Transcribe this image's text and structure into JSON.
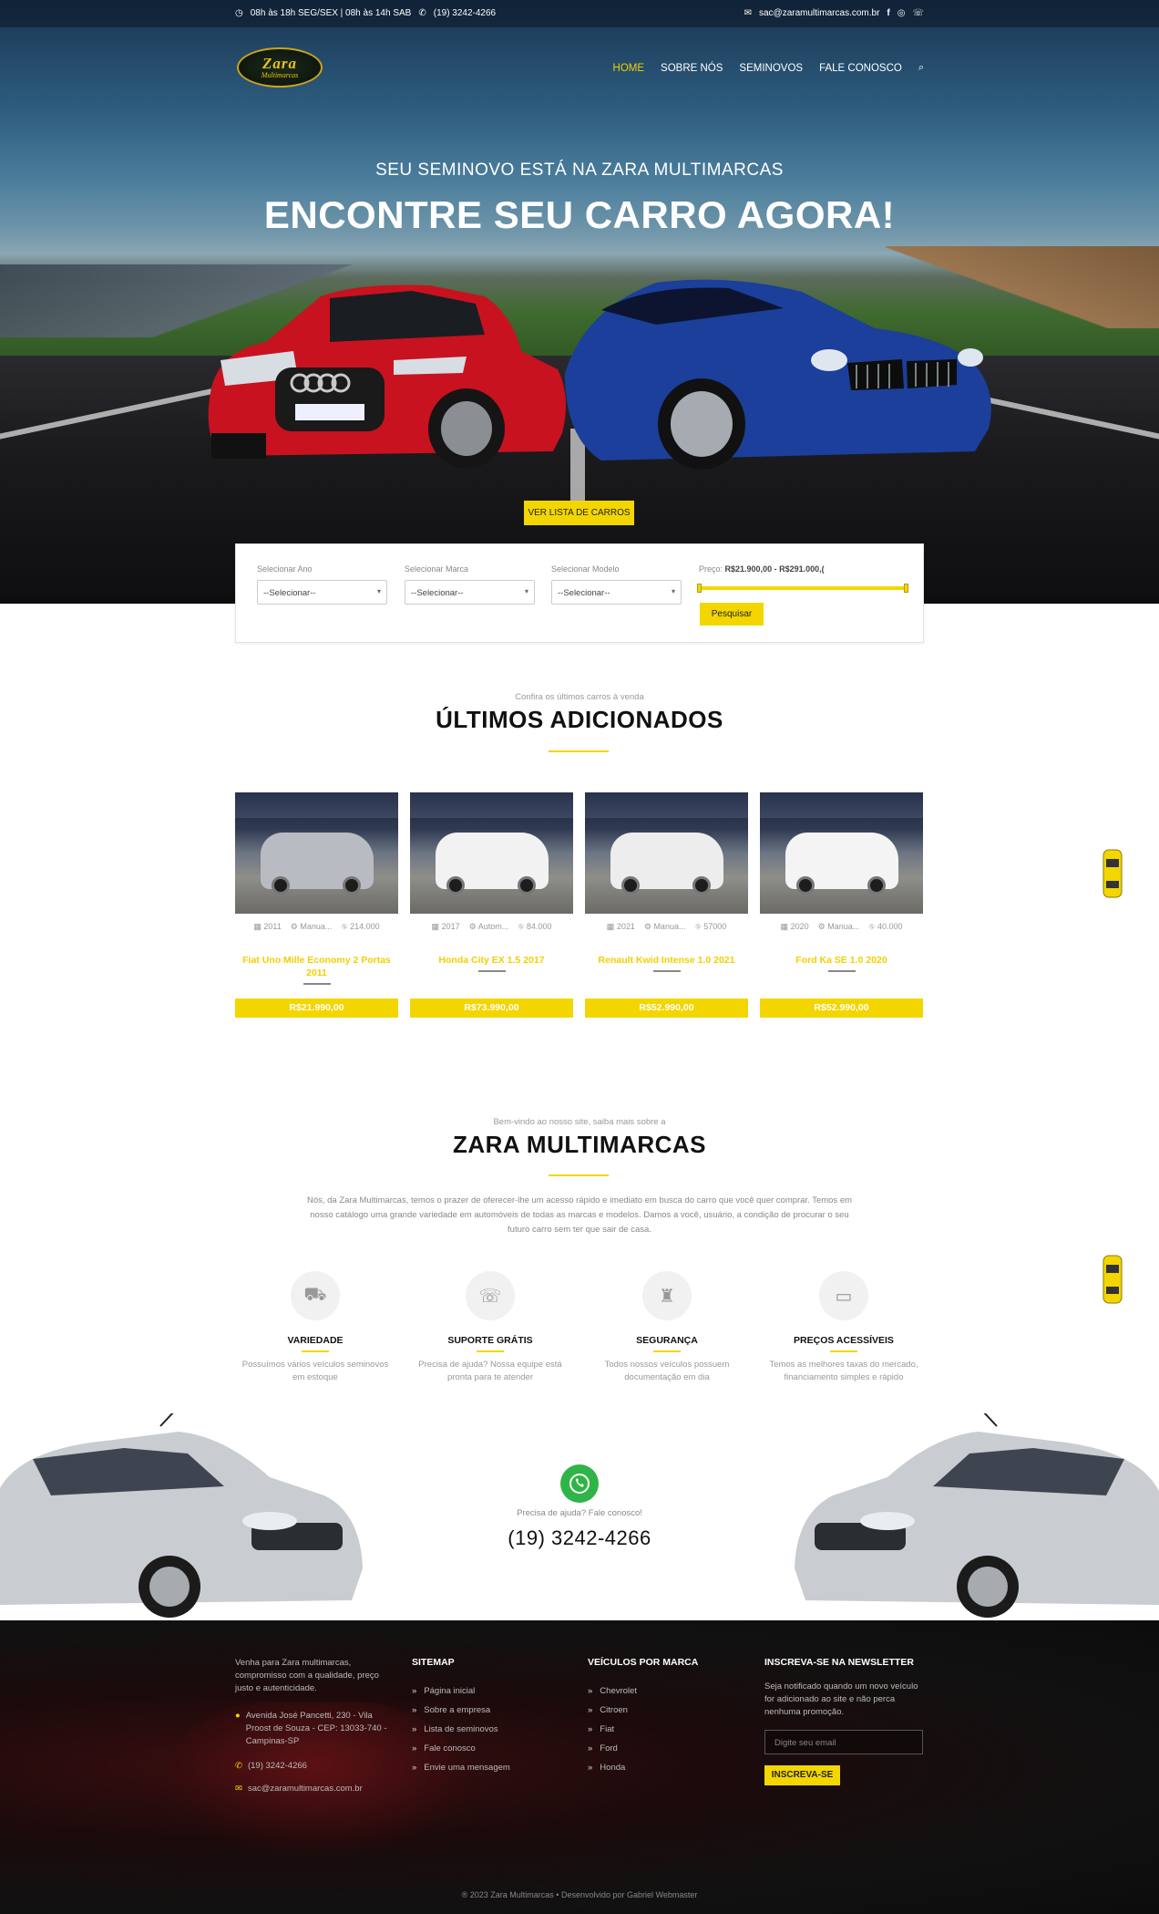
{
  "topbar": {
    "hours": "08h às 18h SEG/SEX | 08h às 14h SAB",
    "phone": "(19) 3242-4266",
    "email": "sac@zaramultimarcas.com.br"
  },
  "logo": {
    "line1": "Zara",
    "line2": "Multimarcas"
  },
  "nav": [
    {
      "label": "HOME",
      "active": true
    },
    {
      "label": "SOBRE NÓS"
    },
    {
      "label": "SEMINOVOS"
    },
    {
      "label": "FALE CONOSCO"
    }
  ],
  "hero": {
    "subtitle": "SEU SEMINOVO ESTÁ NA ZARA MULTIMARCAS",
    "title": "ENCONTRE SEU CARRO AGORA!",
    "button": "VER LISTA DE CARROS"
  },
  "search": {
    "ano_label": "Selecionar Ano",
    "marca_label": "Selecionar Marca",
    "modelo_label": "Selecionar Modelo",
    "select_value": "--Selecionar--",
    "price_label": "Preço:",
    "price_range": "R$21.900,00 - R$291.000,(",
    "price_min": 21900,
    "price_max": 291000,
    "button": "Pesquisar"
  },
  "latest": {
    "kicker": "Confira os últimos carros à venda",
    "title": "ÚLTIMOS ADICIONADOS",
    "cars": [
      {
        "year": "2011",
        "trans": "Manua...",
        "km": "214.000",
        "name": "Fiat Uno Mille Economy 2 Portas 2011",
        "price": "R$21.990,00",
        "color": "#b8bcc2"
      },
      {
        "year": "2017",
        "trans": "Autom...",
        "km": "84.000",
        "name": "Honda City EX 1.5 2017",
        "price": "R$73.990,00",
        "color": "#f2f2f2"
      },
      {
        "year": "2021",
        "trans": "Manua...",
        "km": "57000",
        "name": "Renault Kwid Intense 1.0 2021",
        "price": "R$52.990,00",
        "color": "#ededed"
      },
      {
        "year": "2020",
        "trans": "Manua...",
        "km": "40.000",
        "name": "Ford Ka SE 1.0 2020",
        "price": "R$52.990,00",
        "color": "#f4f4f4"
      }
    ]
  },
  "about": {
    "kicker": "Bem-vindo ao nosso site, saiba mais sobre a",
    "title": "ZARA MULTIMARCAS",
    "text": "Nós, da Zara Multimarcas, temos o prazer de oferecer-lhe um acesso rápido e imediato em busca do carro que você quer comprar. Temos em nosso catálogo uma grande variedade em automóveis de todas as marcas e modelos. Damos a você, usuário, a condição de procurar o seu futuro carro sem ter que sair de casa.",
    "features": [
      {
        "icon": "car-front-icon",
        "title": "VARIEDADE",
        "desc": "Possuímos vários veículos seminovos em estoque"
      },
      {
        "icon": "chat-bubble-icon",
        "title": "SUPORTE GRÁTIS",
        "desc": "Precisa de ajuda? Nossa equipe está pronta para te atender"
      },
      {
        "icon": "fire-extinguisher-icon",
        "title": "SEGURANÇA",
        "desc": "Todos nossos veículos possuem documentação em dia"
      },
      {
        "icon": "wallet-icon",
        "title": "PREÇOS ACESSÍVEIS",
        "desc": "Temos as melhores taxas do mercado, financiamento simples e rápido"
      }
    ]
  },
  "contact": {
    "help": "Precisa de ajuda? Fale conosco!",
    "phone": "(19) 3242-4266"
  },
  "footer": {
    "intro": "Venha para Zara multimarcas, compromisso com a qualidade, preço justo e autenticidade.",
    "address": "Avenida José Pancetti, 230 - Vila Proost de Souza - CEP: 13033-740 - Campinas-SP",
    "phone": "(19) 3242-4266",
    "email": "sac@zaramultimarcas.com.br",
    "sitemap_title": "SITEMAP",
    "sitemap": [
      "Página inicial",
      "Sobre a empresa",
      "Lista de seminovos",
      "Fale conosco",
      "Envie uma mensagem"
    ],
    "brands_title": "VEÍCULOS POR MARCA",
    "brands": [
      "Chevrolet",
      "Citroen",
      "Fiat",
      "Ford",
      "Honda"
    ],
    "newsletter_title": "INSCREVA-SE NA NEWSLETTER",
    "newsletter_text": "Seja notificado quando um novo veículo for adicionado ao site e não perca nenhuma promoção.",
    "newsletter_placeholder": "Digite seu email",
    "newsletter_button": "INSCREVA-SE",
    "copyright": "® 2023 Zara Multimarcas • Desenvolvido por Gabriel Webmaster"
  },
  "colors": {
    "accent": "#f3d600",
    "dark": "#111111"
  }
}
